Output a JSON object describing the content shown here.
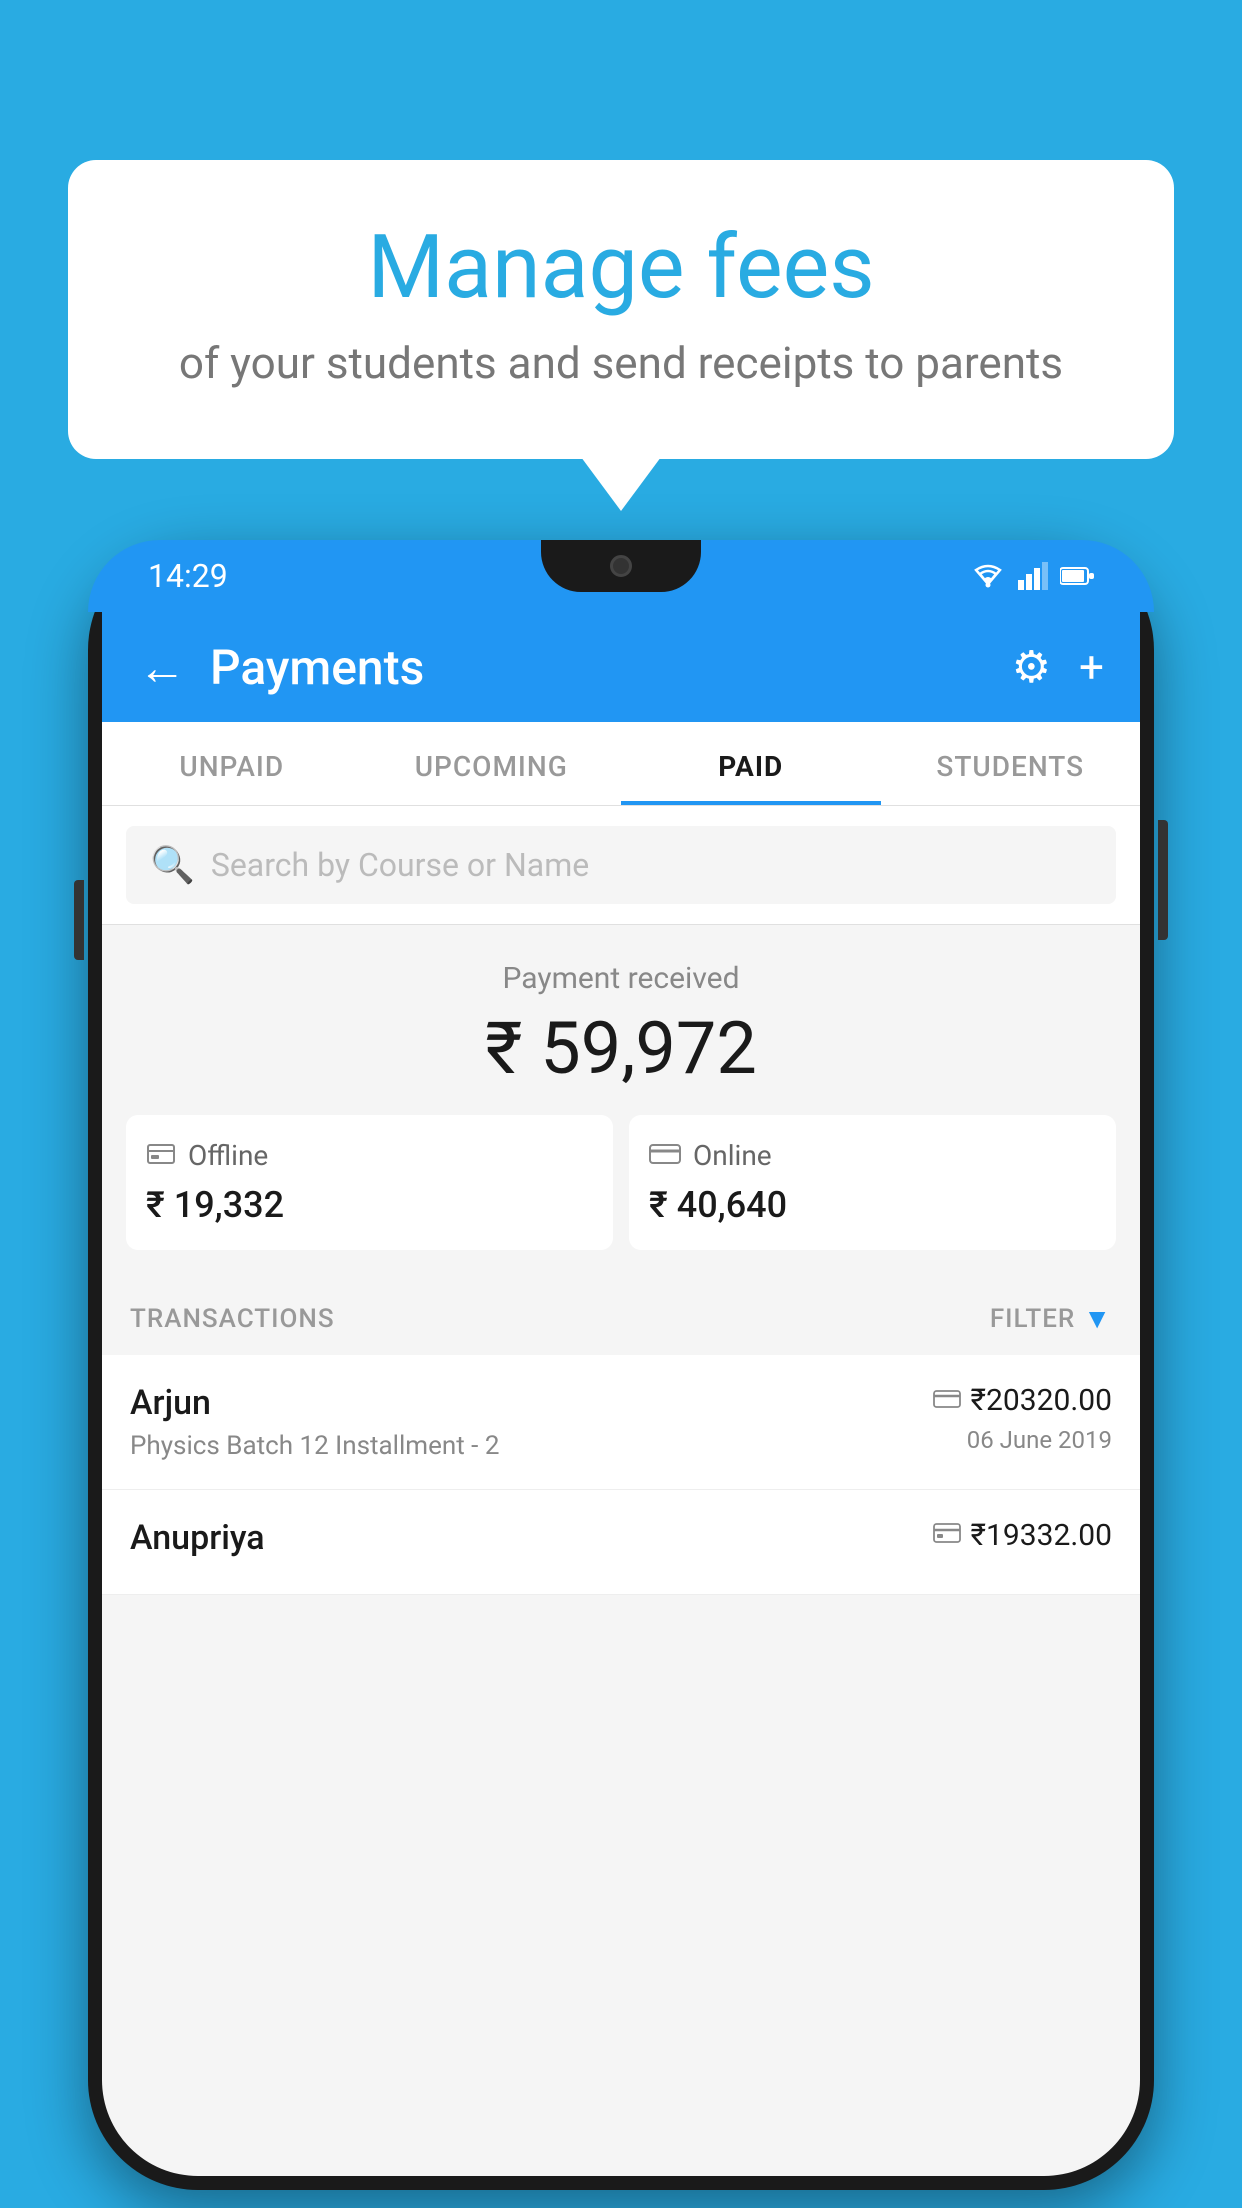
{
  "background_color": "#29ABE2",
  "speech_bubble": {
    "title": "Manage fees",
    "subtitle": "of your students and send receipts to parents"
  },
  "status_bar": {
    "time": "14:29",
    "wifi_icon": "wifi",
    "signal_icon": "signal",
    "battery_icon": "battery"
  },
  "header": {
    "title": "Payments",
    "back_label": "←",
    "settings_icon": "⚙",
    "add_icon": "+"
  },
  "tabs": [
    {
      "label": "UNPAID",
      "active": false
    },
    {
      "label": "UPCOMING",
      "active": false
    },
    {
      "label": "PAID",
      "active": true
    },
    {
      "label": "STUDENTS",
      "active": false
    }
  ],
  "search": {
    "placeholder": "Search by Course or Name"
  },
  "payment_received": {
    "label": "Payment received",
    "amount": "₹ 59,972",
    "offline": {
      "icon": "offline-icon",
      "label": "Offline",
      "amount": "₹ 19,332"
    },
    "online": {
      "icon": "online-icon",
      "label": "Online",
      "amount": "₹ 40,640"
    }
  },
  "transactions": {
    "label": "TRANSACTIONS",
    "filter_label": "FILTER",
    "items": [
      {
        "name": "Arjun",
        "course": "Physics Batch 12 Installment - 2",
        "amount": "₹20320.00",
        "date": "06 June 2019",
        "payment_type": "online"
      },
      {
        "name": "Anupriya",
        "course": "",
        "amount": "₹19332.00",
        "date": "",
        "payment_type": "offline"
      }
    ]
  }
}
